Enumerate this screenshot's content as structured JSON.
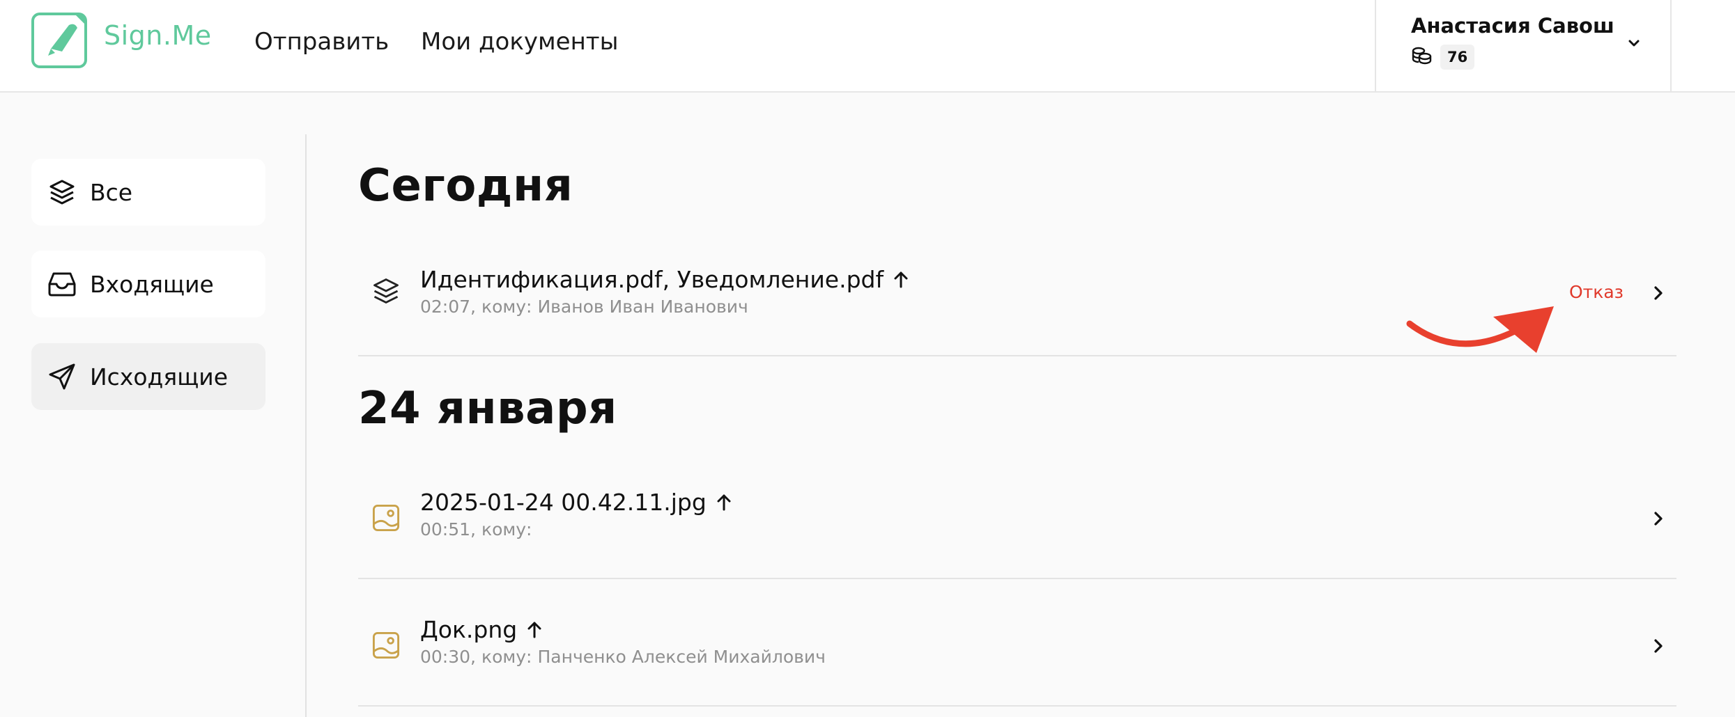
{
  "app": {
    "name": "Sign.Me",
    "brand_color": "#5fc99c",
    "accent_reject": "#e0392b"
  },
  "header": {
    "nav": [
      {
        "label": "Отправить"
      },
      {
        "label": "Мои документы"
      }
    ],
    "user": {
      "name": "Анастасия Савош",
      "balance": "76",
      "balance_icon": "coins-icon",
      "menu_icon": "chevron-down-icon"
    }
  },
  "sidebar": {
    "items": [
      {
        "label": "Все",
        "icon": "layers-icon",
        "active": false
      },
      {
        "label": "Входящие",
        "icon": "inbox-icon",
        "active": false
      },
      {
        "label": "Исходящие",
        "icon": "paper-plane-icon",
        "active": true
      }
    ]
  },
  "sections": [
    {
      "title": "Сегодня",
      "docs": [
        {
          "name": "Идентификация.pdf, Уведомление.pdf",
          "time": "02:07,",
          "to_label": "кому:",
          "recipient": "Иванов Иван Иванович",
          "status": "Отказ",
          "icon": "layers-icon",
          "direction": "outgoing"
        }
      ]
    },
    {
      "title": "24 января",
      "docs": [
        {
          "name": "2025-01-24 00.42.11.jpg",
          "time": "00:51,",
          "to_label": "кому:",
          "recipient": "",
          "status": "",
          "icon": "image-file-icon",
          "direction": "outgoing"
        },
        {
          "name": "Док.png",
          "time": "00:30,",
          "to_label": "кому:",
          "recipient": "Панченко Алексей Михайлович",
          "status": "",
          "icon": "image-file-icon",
          "direction": "outgoing"
        }
      ]
    }
  ]
}
